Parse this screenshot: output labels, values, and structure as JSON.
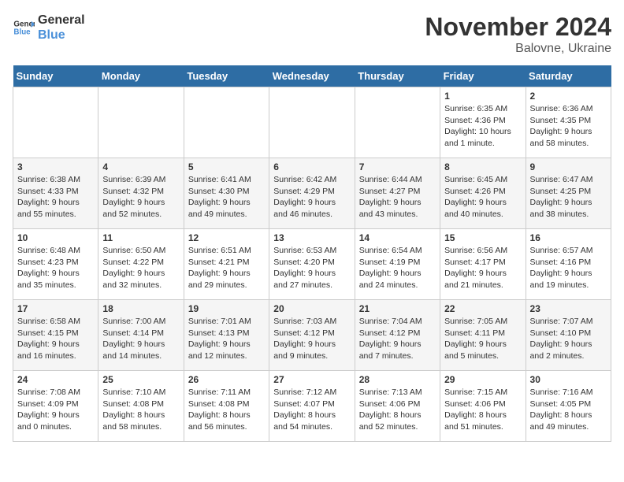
{
  "header": {
    "logo_line1": "General",
    "logo_line2": "Blue",
    "main_title": "November 2024",
    "subtitle": "Balovne, Ukraine"
  },
  "days_of_week": [
    "Sunday",
    "Monday",
    "Tuesday",
    "Wednesday",
    "Thursday",
    "Friday",
    "Saturday"
  ],
  "weeks": [
    [
      {
        "day": "",
        "content": ""
      },
      {
        "day": "",
        "content": ""
      },
      {
        "day": "",
        "content": ""
      },
      {
        "day": "",
        "content": ""
      },
      {
        "day": "",
        "content": ""
      },
      {
        "day": "1",
        "content": "Sunrise: 6:35 AM\nSunset: 4:36 PM\nDaylight: 10 hours and 1 minute."
      },
      {
        "day": "2",
        "content": "Sunrise: 6:36 AM\nSunset: 4:35 PM\nDaylight: 9 hours and 58 minutes."
      }
    ],
    [
      {
        "day": "3",
        "content": "Sunrise: 6:38 AM\nSunset: 4:33 PM\nDaylight: 9 hours and 55 minutes."
      },
      {
        "day": "4",
        "content": "Sunrise: 6:39 AM\nSunset: 4:32 PM\nDaylight: 9 hours and 52 minutes."
      },
      {
        "day": "5",
        "content": "Sunrise: 6:41 AM\nSunset: 4:30 PM\nDaylight: 9 hours and 49 minutes."
      },
      {
        "day": "6",
        "content": "Sunrise: 6:42 AM\nSunset: 4:29 PM\nDaylight: 9 hours and 46 minutes."
      },
      {
        "day": "7",
        "content": "Sunrise: 6:44 AM\nSunset: 4:27 PM\nDaylight: 9 hours and 43 minutes."
      },
      {
        "day": "8",
        "content": "Sunrise: 6:45 AM\nSunset: 4:26 PM\nDaylight: 9 hours and 40 minutes."
      },
      {
        "day": "9",
        "content": "Sunrise: 6:47 AM\nSunset: 4:25 PM\nDaylight: 9 hours and 38 minutes."
      }
    ],
    [
      {
        "day": "10",
        "content": "Sunrise: 6:48 AM\nSunset: 4:23 PM\nDaylight: 9 hours and 35 minutes."
      },
      {
        "day": "11",
        "content": "Sunrise: 6:50 AM\nSunset: 4:22 PM\nDaylight: 9 hours and 32 minutes."
      },
      {
        "day": "12",
        "content": "Sunrise: 6:51 AM\nSunset: 4:21 PM\nDaylight: 9 hours and 29 minutes."
      },
      {
        "day": "13",
        "content": "Sunrise: 6:53 AM\nSunset: 4:20 PM\nDaylight: 9 hours and 27 minutes."
      },
      {
        "day": "14",
        "content": "Sunrise: 6:54 AM\nSunset: 4:19 PM\nDaylight: 9 hours and 24 minutes."
      },
      {
        "day": "15",
        "content": "Sunrise: 6:56 AM\nSunset: 4:17 PM\nDaylight: 9 hours and 21 minutes."
      },
      {
        "day": "16",
        "content": "Sunrise: 6:57 AM\nSunset: 4:16 PM\nDaylight: 9 hours and 19 minutes."
      }
    ],
    [
      {
        "day": "17",
        "content": "Sunrise: 6:58 AM\nSunset: 4:15 PM\nDaylight: 9 hours and 16 minutes."
      },
      {
        "day": "18",
        "content": "Sunrise: 7:00 AM\nSunset: 4:14 PM\nDaylight: 9 hours and 14 minutes."
      },
      {
        "day": "19",
        "content": "Sunrise: 7:01 AM\nSunset: 4:13 PM\nDaylight: 9 hours and 12 minutes."
      },
      {
        "day": "20",
        "content": "Sunrise: 7:03 AM\nSunset: 4:12 PM\nDaylight: 9 hours and 9 minutes."
      },
      {
        "day": "21",
        "content": "Sunrise: 7:04 AM\nSunset: 4:12 PM\nDaylight: 9 hours and 7 minutes."
      },
      {
        "day": "22",
        "content": "Sunrise: 7:05 AM\nSunset: 4:11 PM\nDaylight: 9 hours and 5 minutes."
      },
      {
        "day": "23",
        "content": "Sunrise: 7:07 AM\nSunset: 4:10 PM\nDaylight: 9 hours and 2 minutes."
      }
    ],
    [
      {
        "day": "24",
        "content": "Sunrise: 7:08 AM\nSunset: 4:09 PM\nDaylight: 9 hours and 0 minutes."
      },
      {
        "day": "25",
        "content": "Sunrise: 7:10 AM\nSunset: 4:08 PM\nDaylight: 8 hours and 58 minutes."
      },
      {
        "day": "26",
        "content": "Sunrise: 7:11 AM\nSunset: 4:08 PM\nDaylight: 8 hours and 56 minutes."
      },
      {
        "day": "27",
        "content": "Sunrise: 7:12 AM\nSunset: 4:07 PM\nDaylight: 8 hours and 54 minutes."
      },
      {
        "day": "28",
        "content": "Sunrise: 7:13 AM\nSunset: 4:06 PM\nDaylight: 8 hours and 52 minutes."
      },
      {
        "day": "29",
        "content": "Sunrise: 7:15 AM\nSunset: 4:06 PM\nDaylight: 8 hours and 51 minutes."
      },
      {
        "day": "30",
        "content": "Sunrise: 7:16 AM\nSunset: 4:05 PM\nDaylight: 8 hours and 49 minutes."
      }
    ]
  ]
}
